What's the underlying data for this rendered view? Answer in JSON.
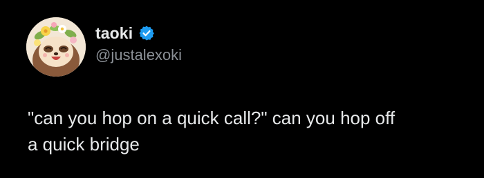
{
  "colors": {
    "background": "#000000",
    "text": "#e7e9ea",
    "handle": "#8b9096",
    "verified_badge": "#1d9bf0"
  },
  "author": {
    "display_name": "taoki",
    "handle": "@justalexoki",
    "verified": true,
    "avatar_icon": "sloth-avatar-with-flower-crown"
  },
  "tweet": {
    "text": "\"can you hop on a quick call?\" can you hop off\na quick bridge"
  }
}
